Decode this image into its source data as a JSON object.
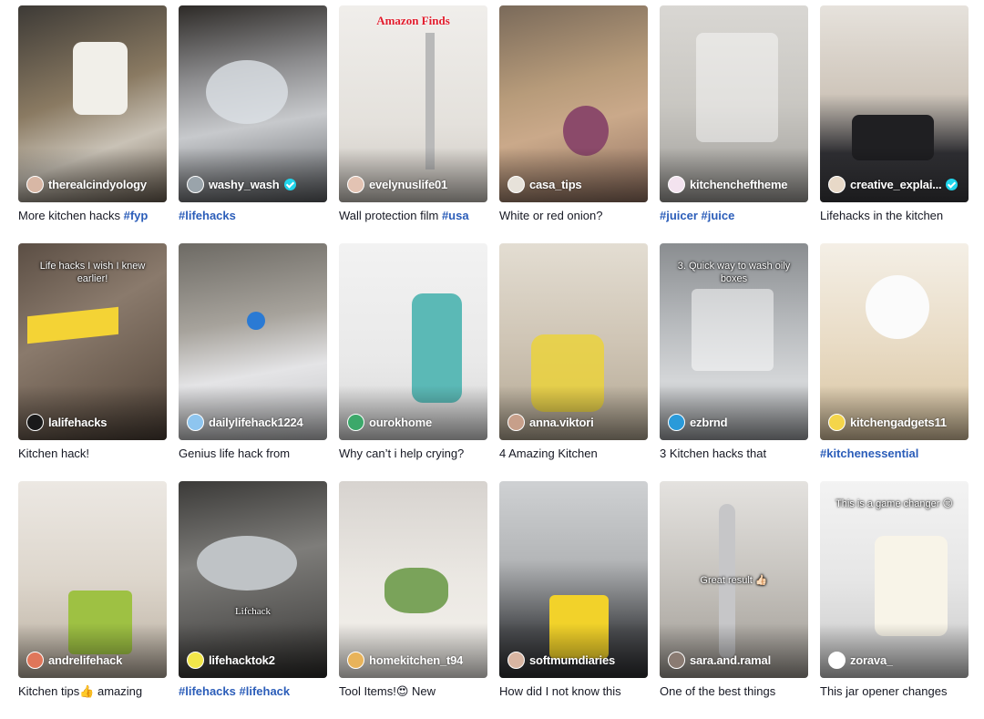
{
  "colors": {
    "hashtag": "#2b5db9",
    "verified": "#20d5ec"
  },
  "videos": [
    {
      "author": "therealcindyology",
      "verified": false,
      "caption": "More kitchen hacks ",
      "tags": "#fyp",
      "overlay": "",
      "overlay_top": "",
      "bg": "linear-gradient(160deg,#3d3a36 0%,#8a7a62 45%,#c9c2b6 70%,#6d6153 100%)",
      "avatar_color": "#d8b7a5",
      "avatar_icon": "avatar"
    },
    {
      "author": "washy_wash",
      "verified": true,
      "caption": "",
      "tags": "#lifehacks",
      "overlay": "",
      "overlay_top": "",
      "bg": "linear-gradient(170deg,#2d2a27 0%,#8d8d8f 35%,#c7c9cc 60%,#5c5f63 100%)",
      "avatar_color": "#9aa4ab",
      "avatar_icon": "avatar"
    },
    {
      "author": "evelynuslife01",
      "verified": false,
      "caption": "Wall protection film ",
      "tags": "#usa",
      "overlay": "",
      "overlay_top": "Amazon Finds",
      "bg": "linear-gradient(180deg,#f0eeeb 0%,#e4e1dc 60%,#cfc9c2 100%)",
      "avatar_color": "#e3c3b3",
      "avatar_icon": "avatar"
    },
    {
      "author": "casa_tips",
      "verified": false,
      "caption": "White or red onion?",
      "tags": "",
      "overlay": "",
      "overlay_top": "",
      "bg": "linear-gradient(165deg,#7a6a5a 0%,#b79b7a 40%,#caa98a 60%,#8f6f5f 100%)",
      "avatar_color": "#e7e2da",
      "avatar_icon": "avatar"
    },
    {
      "author": "kitchencheftheme",
      "verified": false,
      "caption": "",
      "tags": "#juicer #juice",
      "overlay": "",
      "overlay_top": "",
      "bg": "linear-gradient(180deg,#d9d7d3 0%,#c9c7c2 50%,#9e9c98 100%)",
      "avatar_color": "#f3e3ef",
      "avatar_icon": "avatar"
    },
    {
      "author": "creative_explai...",
      "verified": true,
      "caption": "Lifehacks in the kitchen",
      "tags": "",
      "overlay": "",
      "overlay_top": "",
      "bg": "linear-gradient(180deg,#e6e2dc 0%,#cfc6bb 45%,#2f2f33 75%,#3a3a3e 100%)",
      "avatar_color": "#e8d9c8",
      "avatar_icon": "avatar"
    },
    {
      "author": "lalifehacks",
      "verified": false,
      "caption": "Kitchen hack!",
      "tags": "",
      "overlay": "",
      "overlay_top": "Life hacks I wish I knew earlier!",
      "bg": "linear-gradient(150deg,#5b4e44 0%,#8a7a6c 40%,#6e5f52 70%,#4a3e35 100%)",
      "avatar_color": "#1a1a1a",
      "avatar_icon": "avatar"
    },
    {
      "author": "dailylifehack1224",
      "verified": false,
      "caption": "Genius life hack from",
      "tags": "",
      "overlay": "",
      "overlay_top": "",
      "bg": "linear-gradient(170deg,#6d6a64 0%,#a7a39c 40%,#e4e4e6 65%,#bfc0c2 100%)",
      "avatar_color": "#8ec5ef",
      "avatar_icon": "avatar"
    },
    {
      "author": "ourokhome",
      "verified": false,
      "caption": "Why can’t i help crying?",
      "tags": "",
      "overlay": "",
      "overlay_top": "",
      "bg": "linear-gradient(180deg,#f2f2f2 0%,#e9e9e9 60%,#d8d8d8 100%)",
      "avatar_color": "#3ca86a",
      "avatar_icon": "avatar"
    },
    {
      "author": "anna.viktori",
      "verified": false,
      "caption": "4 Amazing Kitchen",
      "tags": "",
      "overlay": "",
      "overlay_top": "",
      "bg": "linear-gradient(180deg,#e3ddd2 0%,#cfc5b5 50%,#b3a793 100%)",
      "avatar_color": "#c79f8a",
      "avatar_icon": "avatar"
    },
    {
      "author": "ezbrnd",
      "verified": false,
      "caption": "3 Kitchen hacks that",
      "tags": "",
      "overlay": "",
      "overlay_top": "3. Quick way to wash oily boxes",
      "bg": "linear-gradient(180deg,#8a8d90 0%,#b6b9bc 40%,#d4d6d8 70%,#a0a3a6 100%)",
      "avatar_color": "#2a9ad9",
      "avatar_icon": "avatar"
    },
    {
      "author": "kitchengadgets11",
      "verified": false,
      "caption": "",
      "tags": "#kitchenessential",
      "overlay": "",
      "overlay_top": "",
      "bg": "linear-gradient(180deg,#f4efe6 0%,#e9dcc6 50%,#d8c39f 100%)",
      "avatar_color": "#f4d54a",
      "avatar_icon": "avatar"
    },
    {
      "author": "andrelifehack",
      "verified": false,
      "caption": "Kitchen tips👍 amazing",
      "tags": "",
      "overlay": "",
      "overlay_top": "",
      "bg": "linear-gradient(180deg,#ece8e3 0%,#ddd6cc 50%,#b9ae9f 100%)",
      "avatar_color": "#e0765a",
      "avatar_icon": "avatar"
    },
    {
      "author": "lifehacktok2",
      "verified": false,
      "caption": "",
      "tags": "#lifehacks #lifehack",
      "overlay": "Lifchack",
      "overlay_top": "",
      "bg": "linear-gradient(170deg,#3b3a38 0%,#7e7d7a 40%,#5a5957 70%,#2c2b29 100%)",
      "avatar_color": "#f2e64a",
      "avatar_icon": "avatar"
    },
    {
      "author": "homekitchen_t94",
      "verified": false,
      "caption": "Tool Items!😍 New",
      "tags": "",
      "overlay": "",
      "overlay_top": "",
      "bg": "linear-gradient(180deg,#d7d3cf 0%,#ebe8e3 50%,#f4f1ec 100%)",
      "avatar_color": "#e8b35a",
      "avatar_icon": "avatar"
    },
    {
      "author": "softmumdiaries",
      "verified": false,
      "caption": "How did I not know this",
      "tags": "",
      "overlay": "",
      "overlay_top": "",
      "bg": "linear-gradient(180deg,#cfd1d3 0%,#b4b6b8 40%,#4d4f52 75%,#2f3033 100%)",
      "avatar_color": "#d8b5a2",
      "avatar_icon": "avatar"
    },
    {
      "author": "sara.and.ramal",
      "verified": false,
      "caption": "One of the best things",
      "tags": "",
      "overlay": "Great result 👍🏻",
      "overlay_top": "",
      "bg": "linear-gradient(180deg,#e4e2df 0%,#c9c6c1 45%,#9f9a93 100%)",
      "avatar_color": "#8a7b72",
      "avatar_icon": "avatar"
    },
    {
      "author": "zorava_",
      "verified": false,
      "caption": "This jar opener changes",
      "tags": "",
      "overlay": "",
      "overlay_top": "This is a game changer 😏",
      "bg": "linear-gradient(180deg,#f3f3f3 0%,#e6e6e6 50%,#c8c8c8 100%)",
      "avatar_color": "#ffffff",
      "avatar_icon": "zorava-logo"
    }
  ]
}
